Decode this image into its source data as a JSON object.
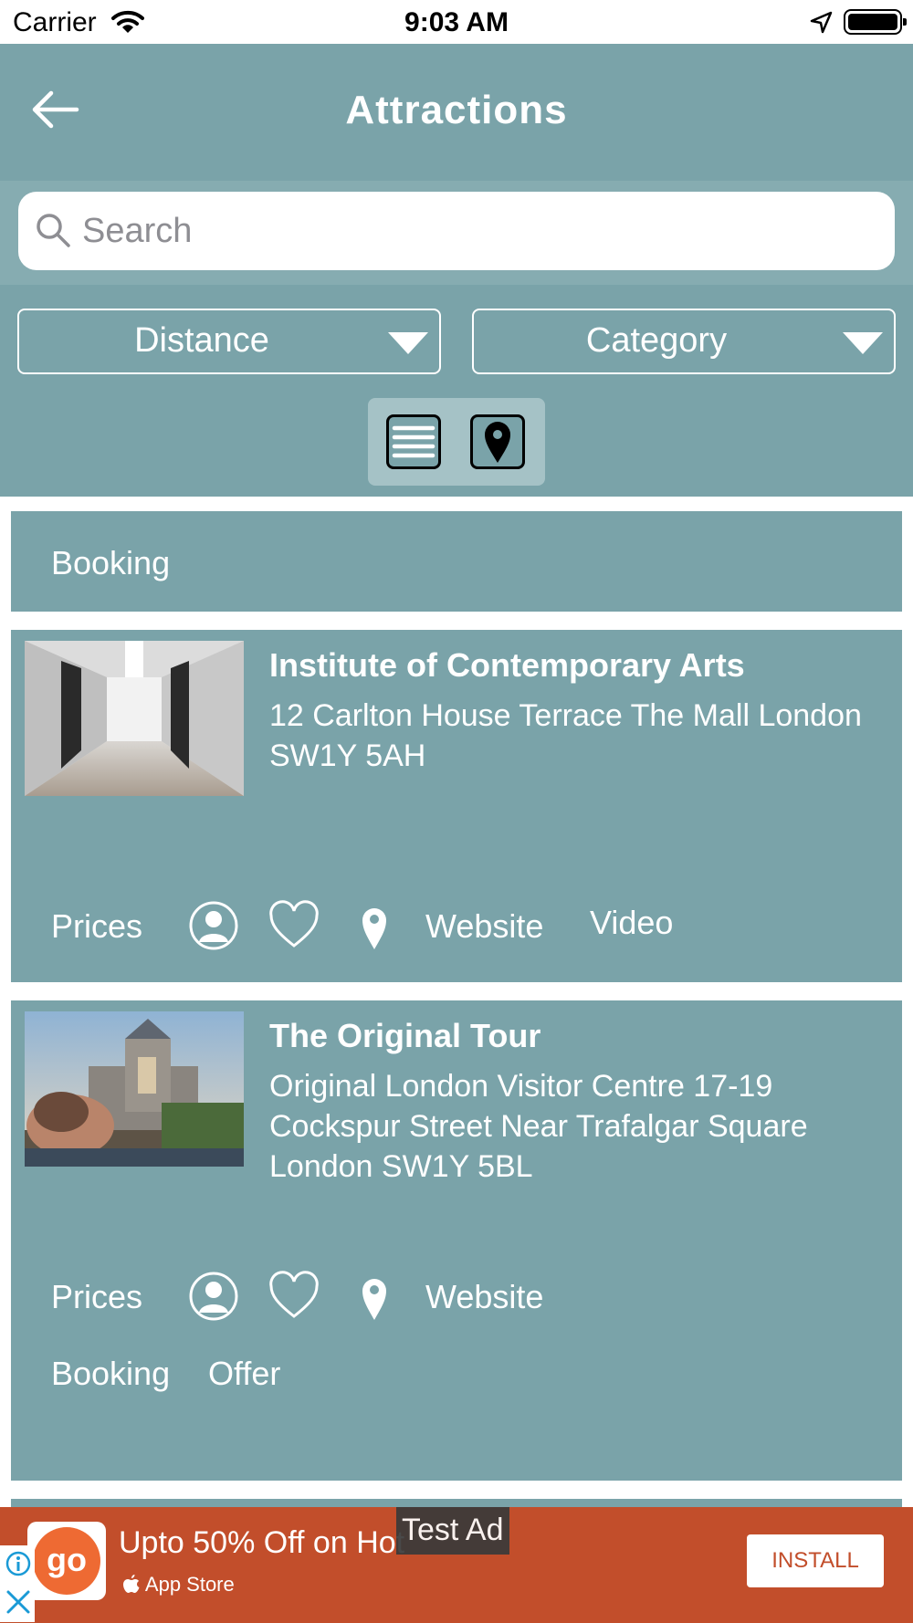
{
  "status_bar": {
    "carrier": "Carrier",
    "time": "9:03 AM"
  },
  "header": {
    "title": "Attractions"
  },
  "search": {
    "placeholder": "Search"
  },
  "filters": {
    "distance_label": "Distance",
    "category_label": "Category"
  },
  "list": {
    "partial_item": {
      "booking_label": "Booking"
    },
    "items": [
      {
        "title": "Institute of Contemporary Arts",
        "address": "12 Carlton House Terrace The Mall London   SW1Y 5AH",
        "prices_label": "Prices",
        "website_label": "Website",
        "video_label": "Video"
      },
      {
        "title": "The Original Tour",
        "address": "Original London Visitor Centre 17-19 Cockspur Street Near Trafalgar Square London  SW1Y 5BL",
        "prices_label": "Prices",
        "website_label": "Website",
        "booking_label": "Booking",
        "offer_label": "Offer"
      }
    ]
  },
  "ad": {
    "test_label": "Test Ad",
    "headline": "Upto 50% Off on Hot",
    "store": "App Store",
    "install_label": "INSTALL",
    "app_icon_text": "go"
  },
  "colors": {
    "header": "#7aa3a9",
    "ad_background": "#c24e2b"
  }
}
